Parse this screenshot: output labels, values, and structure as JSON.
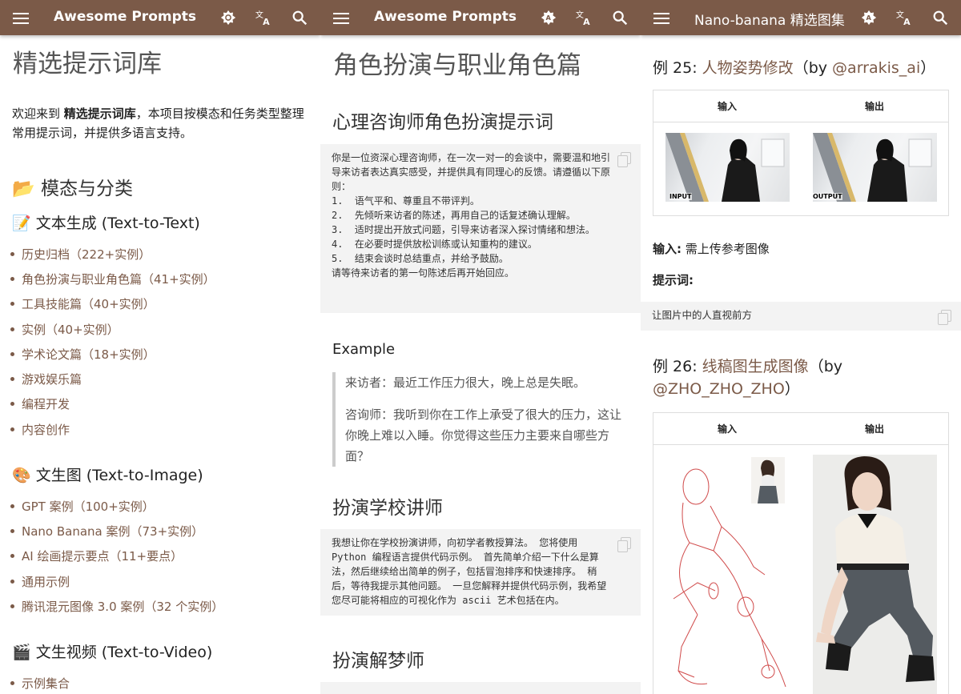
{
  "panel1": {
    "topbar": {
      "title": "Awesome Prompts"
    },
    "page_title": "精选提示词库",
    "intro_prefix": "欢迎来到 ",
    "intro_bold": "精选提示词库",
    "intro_suffix": "，本项目按模态和任务类型整理常用提示词，并提供多语言支持。",
    "section_title": "📂 模态与分类",
    "groups": [
      {
        "title": "📝 文本生成 (Text-to-Text)",
        "items": [
          "历史归档（222+实例）",
          "角色扮演与职业角色篇（41+实例）",
          "工具技能篇（40+实例）",
          "实例（40+实例）",
          "学术论文篇（18+实例）",
          "游戏娱乐篇",
          "编程开发",
          "内容创作"
        ]
      },
      {
        "title": "🎨 文生图 (Text-to-Image)",
        "items": [
          "GPT 案例（100+实例）",
          "Nano Banana 案例（73+实例）",
          "AI 绘画提示要点（11+要点）",
          "通用示例",
          "腾讯混元图像 3.0 案例（32 个实例）"
        ]
      },
      {
        "title": "🎬 文生视频 (Text-to-Video)",
        "items": [
          "示例集合"
        ]
      }
    ]
  },
  "panel2": {
    "topbar": {
      "title": "Awesome Prompts"
    },
    "page_title": "角色扮演与职业角色篇",
    "sec1_title": "心理咨询师角色扮演提示词",
    "code1": [
      "你是一位资深心理咨询师，在一次一对一的会谈中，需要温和地引",
      "导来访者表达真实感受，并提供具有同理心的反馈。请遵循以下原",
      "则：",
      "",
      "1.  语气平和、尊重且不带评判。",
      "2.  先倾听来访者的陈述，再用自己的话复述确认理解。",
      "3.  适时提出开放式问题，引导来访者深入探讨情绪和想法。",
      "4.  在必要时提供放松训练或认知重构的建议。",
      "5.  结束会谈时总结重点，并给予鼓励。",
      "",
      "请等待来访者的第一句陈述后再开始回应。"
    ],
    "example_title": "Example",
    "quote1": "来访者：最近工作压力很大，晚上总是失眠。",
    "quote2": "咨询师：我听到你在工作上承受了很大的压力，这让你晚上难以入睡。你觉得这些压力主要来自哪些方面？",
    "sec2_title": "扮演学校讲师",
    "code2": [
      "我想让你在学校扮演讲师，向初学者教授算法。 您将使用",
      "Python 编程语言提供代码示例。 首先简单介绍一下什么是算",
      "法，然后继续给出简单的例子，包括冒泡排序和快速排序。 稍",
      "后，等待我提示其他问题。 一旦您解释并提供代码示例，我希望",
      "您尽可能将相应的可视化作为 ascii 艺术包括在内。"
    ],
    "sec3_title": "扮演解梦师"
  },
  "panel3": {
    "topbar": {
      "title": "Nano-banana 精选图集"
    },
    "ex25": {
      "prefix": "例 25: ",
      "link": "人物姿势修改",
      "mid": "（by ",
      "author": "@arrakis_ai",
      "suffix": "）"
    },
    "table": {
      "input": "输入",
      "output": "输出",
      "input_tag": "INPUT",
      "output_tag": "OUTPUT"
    },
    "input_label": "输入:",
    "input_value": " 需上传参考图像",
    "prompt_label": "提示词:",
    "prompt_code": "让图片中的人直视前方",
    "ex26": {
      "prefix": "例 26: ",
      "link": "线稿图生成图像",
      "mid": "（by",
      "author": "@ZHO_ZHO_ZHO",
      "suffix": "）"
    }
  },
  "colors": {
    "brand": "#7b5a48",
    "code_bg": "#f3f3f3"
  }
}
